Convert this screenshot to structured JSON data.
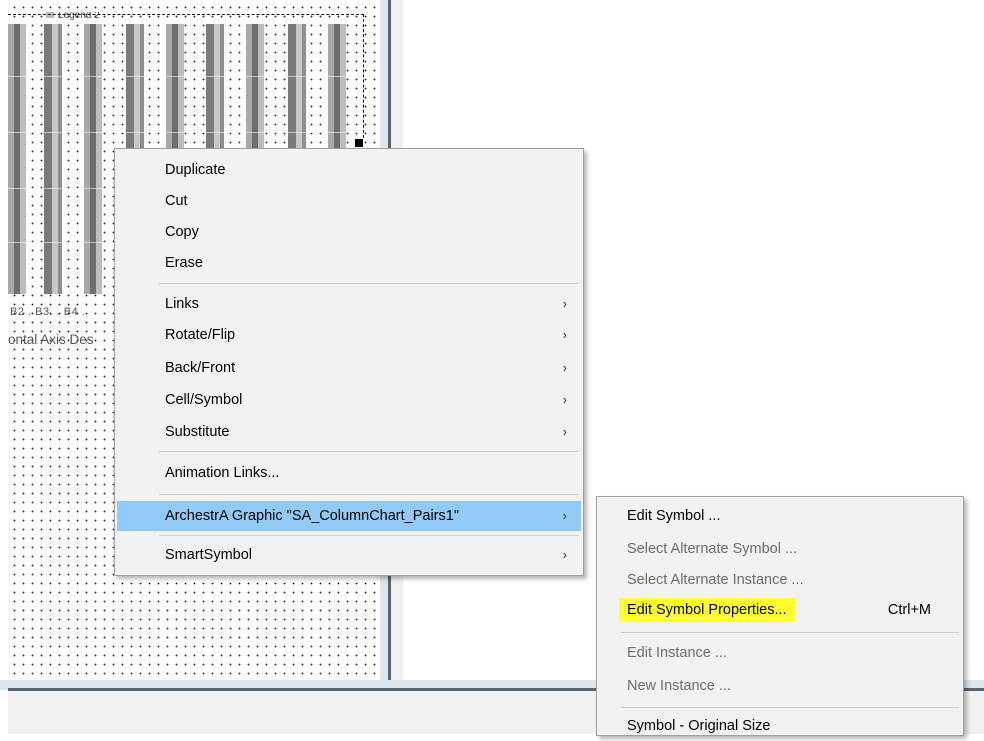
{
  "chart": {
    "legend_text": "Legend 2",
    "tick_labels": "B2 . B3. . B4 .",
    "axis_description": "ontal Axis Des"
  },
  "context_menu": {
    "items": [
      {
        "label": "Duplicate"
      },
      {
        "label": "Cut"
      },
      {
        "label": "Copy"
      },
      {
        "label": "Erase"
      },
      {
        "label": "Links",
        "submenu": true
      },
      {
        "label": "Rotate/Flip",
        "submenu": true
      },
      {
        "label": "Back/Front",
        "submenu": true
      },
      {
        "label": "Cell/Symbol",
        "submenu": true
      },
      {
        "label": "Substitute",
        "submenu": true
      },
      {
        "label": "Animation Links..."
      },
      {
        "label": "ArchestrA Graphic \"SA_ColumnChart_Pairs1\"",
        "submenu": true,
        "highlighted": true
      },
      {
        "label": "SmartSymbol",
        "submenu": true
      }
    ],
    "arrow_glyph": "›"
  },
  "submenu": {
    "items": [
      {
        "label": "Edit Symbol ...",
        "enabled": true
      },
      {
        "label": "Select Alternate Symbol ...",
        "enabled": false
      },
      {
        "label": "Select Alternate Instance ...",
        "enabled": false
      },
      {
        "label": "Edit Symbol Properties...",
        "enabled": true,
        "shortcut": "Ctrl+M",
        "marker_color": "#ffff2e"
      },
      {
        "label": "Edit Instance ...",
        "enabled": false
      },
      {
        "label": "New Instance ...",
        "enabled": false
      },
      {
        "label": "Symbol - Original Size",
        "enabled": true
      }
    ]
  },
  "colors": {
    "menu_highlight": "#91c9f7",
    "marker_yellow": "#ffff2e"
  }
}
